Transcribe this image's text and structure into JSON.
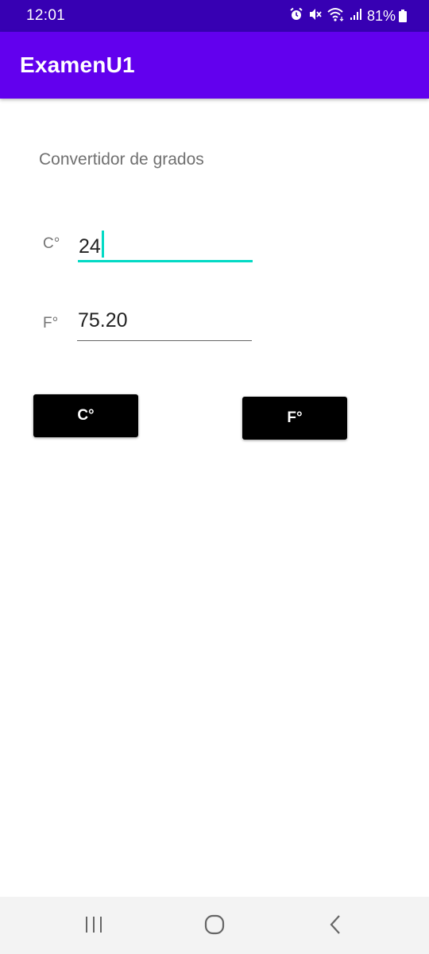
{
  "status_bar": {
    "time": "12:01",
    "battery": "81%",
    "icons": [
      "alarm-icon",
      "mute-icon",
      "wifi-icon",
      "signal-icon",
      "battery-icon"
    ]
  },
  "app_bar": {
    "title": "ExamenU1",
    "color": "#6200ee"
  },
  "converter": {
    "subtitle": "Convertidor de grados",
    "celsius_label": "C°",
    "celsius_value": "24",
    "fahrenheit_label": "F°",
    "fahrenheit_value": "75.20",
    "btn_celsius": "C°",
    "btn_fahrenheit": "F°",
    "accent": "#03dac5"
  },
  "nav_bar": {
    "items": [
      "recents-icon",
      "home-icon",
      "back-icon"
    ]
  }
}
